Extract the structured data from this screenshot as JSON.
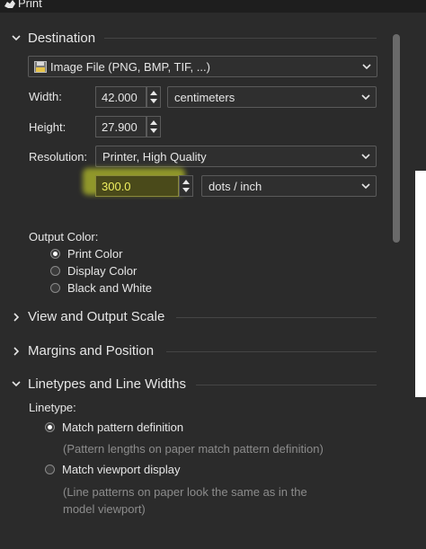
{
  "window": {
    "title": "Print"
  },
  "sections": {
    "destination": "Destination",
    "view_output_scale": "View and Output Scale",
    "margins_position": "Margins and Position",
    "linetypes": "Linetypes and Line Widths"
  },
  "destination": {
    "printer": "Image File (PNG, BMP, TIF, ...)",
    "width_label": "Width:",
    "width_value": "42.000",
    "width_unit": "centimeters",
    "height_label": "Height:",
    "height_value": "27.900",
    "resolution_label": "Resolution:",
    "resolution_preset": "Printer, High Quality",
    "dpi_value": "300.0",
    "dpi_unit": "dots / inch",
    "output_color_label": "Output Color:",
    "color_options": [
      "Print Color",
      "Display Color",
      "Black and White"
    ],
    "color_selected": "Print Color"
  },
  "linetypes": {
    "label": "Linetype:",
    "opt1": "Match pattern definition",
    "opt1_hint": "(Pattern lengths on paper match pattern definition)",
    "opt2": "Match viewport display",
    "opt2_hint_1": "(Line patterns on paper look the same as in the",
    "opt2_hint_2": "model viewport)",
    "selected": "Match pattern definition"
  },
  "colors": {
    "highlight": "#e3f02a",
    "radio_on": "#ffffff"
  }
}
